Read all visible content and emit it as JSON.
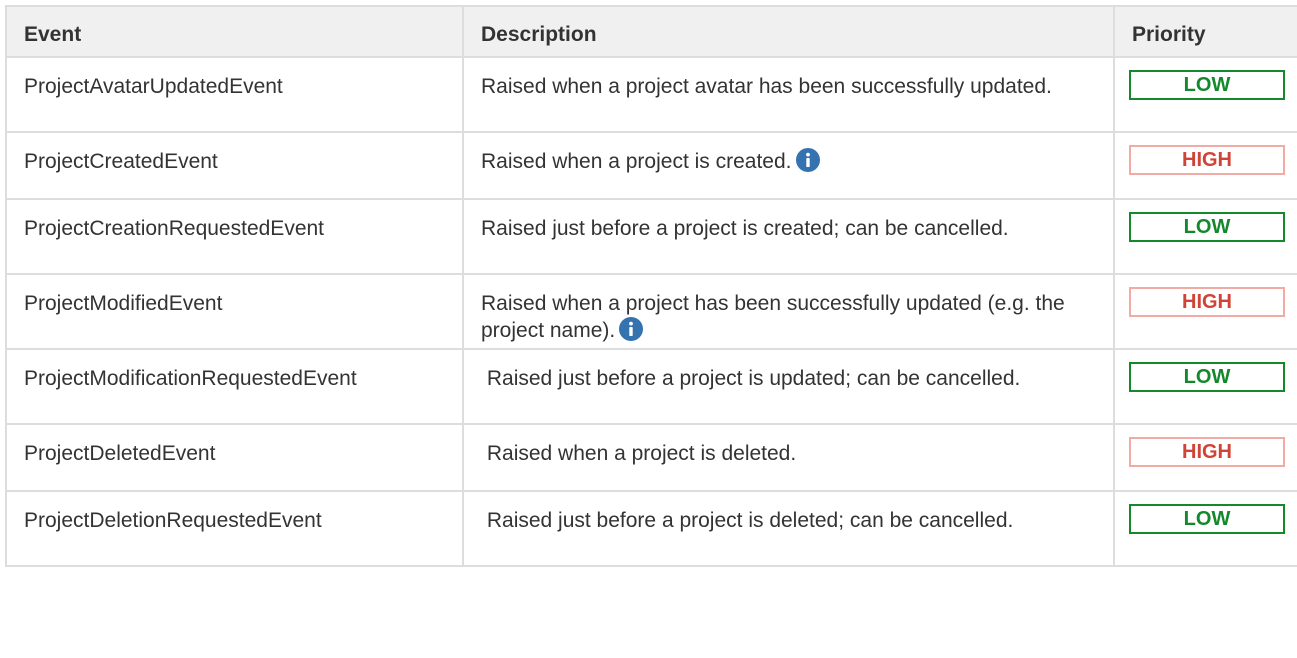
{
  "table": {
    "headers": {
      "event": "Event",
      "description": "Description",
      "priority": "Priority"
    },
    "rows": [
      {
        "event": "ProjectAvatarUpdatedEvent",
        "description": "Raised when a project avatar has been successfully updated.",
        "priority": "LOW",
        "has_info": false
      },
      {
        "event": "ProjectCreatedEvent",
        "description": "Raised when a project is created.",
        "priority": "HIGH",
        "has_info": true
      },
      {
        "event": "ProjectCreationRequestedEvent",
        "description": "Raised just before a project is created; can be cancelled.",
        "priority": "LOW",
        "has_info": false
      },
      {
        "event": "ProjectModifiedEvent",
        "description": "Raised when a project has been successfully updated (e.g. the project name).",
        "priority": "HIGH",
        "has_info": true
      },
      {
        "event": "ProjectModificationRequestedEvent",
        "description": " Raised just before a project is updated; can be cancelled.",
        "priority": "LOW",
        "has_info": false
      },
      {
        "event": "ProjectDeletedEvent",
        "description": " Raised when a project is deleted.",
        "priority": "HIGH",
        "has_info": false
      },
      {
        "event": "ProjectDeletionRequestedEvent",
        "description": " Raised just before a project is deleted; can be cancelled.",
        "priority": "LOW",
        "has_info": false
      }
    ]
  },
  "colors": {
    "low": "#14892c",
    "high": "#d04437",
    "info_icon": "#3572b0",
    "border": "#dddddd",
    "header_bg": "#f0f0f0"
  }
}
